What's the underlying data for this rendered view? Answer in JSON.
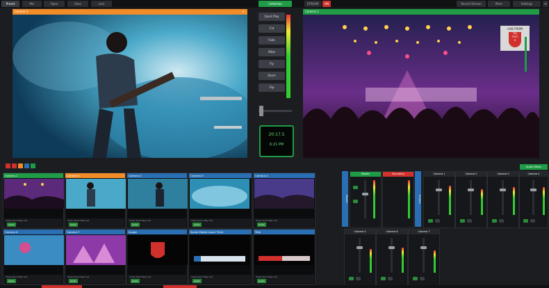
{
  "topbar": {
    "left_tabs": [
      "Preset",
      "Mix",
      "Open",
      "Save",
      "Last"
    ],
    "center_tab": "Collection",
    "right_label": "STREAM",
    "right_badge": "ON",
    "right_tabs": [
      "Record Stream",
      "More",
      "Settings"
    ]
  },
  "preview": {
    "title": "Camera 3",
    "color": "#f28c28"
  },
  "program": {
    "title": "Camera 1",
    "color": "#1f9c45"
  },
  "program_overlay": {
    "line1": "LIVE FROM",
    "line2": "Tiki",
    "line3": "FEST",
    "line4": "8"
  },
  "transitions": [
    "Quick Play",
    "Cut",
    "Fade",
    "Wipe",
    "Fly",
    "Zoom",
    "Flip"
  ],
  "clock": {
    "time": "20:17.5",
    "sub": "6:21 PM"
  },
  "sources_row1": [
    {
      "title": "Camera 1",
      "color": "#1f9c45",
      "ctrl": "Close  Quick Play  Cut",
      "badge": "Audio"
    },
    {
      "title": "Camera 3",
      "color": "#f28c28",
      "ctrl": "Close  Quick Play  Cut",
      "badge": "Audio"
    },
    {
      "title": "Camera 2",
      "color": "#2a6fb4",
      "ctrl": "Close  Quick Play  Cut",
      "badge": "Audio"
    },
    {
      "title": "Camera 5",
      "color": "#2a6fb4",
      "ctrl": "Close  Quick Play  Cut",
      "badge": "Audio"
    },
    {
      "title": "Camera 4",
      "color": "#2a6fb4",
      "ctrl": "Close  Quick Play  Cut",
      "badge": "Audio"
    }
  ],
  "sources_row2": [
    {
      "title": "Camera 6",
      "color": "#2a6fb4",
      "ctrl": "Close  Quick Play  Cut",
      "badge": "Audio"
    },
    {
      "title": "Camera 7",
      "color": "#2a6fb4",
      "ctrl": "Close  Quick Play  Cut",
      "badge": "Audio"
    },
    {
      "title": "Image",
      "color": "#2a6fb4",
      "ctrl": "Close  Quick Play  Cut",
      "badge": "Audio"
    },
    {
      "title": "Social Media Lower Third",
      "color": "#2a6fb4",
      "ctrl": "Close  Quick Play  Cut",
      "badge": "Audio"
    },
    {
      "title": "Title",
      "color": "#2a6fb4",
      "ctrl": "Close  Quick Play  Cut",
      "badge": "Audio"
    }
  ],
  "audio_header": "Audio Mixer",
  "master_labels": {
    "master": "Master",
    "recording": "Recording",
    "side": "Master",
    "side2": "Stream"
  },
  "mixer_top": [
    "Camera 1",
    "Camera 2",
    "Camera 3",
    "Camera 4"
  ],
  "mixer_bottom": [
    "Camera 5",
    "Camera 6",
    "Camera 7"
  ],
  "colors": {
    "green": "#1f9c45",
    "orange": "#f28c28",
    "blue": "#2a6fb4",
    "red": "#d0312d"
  }
}
